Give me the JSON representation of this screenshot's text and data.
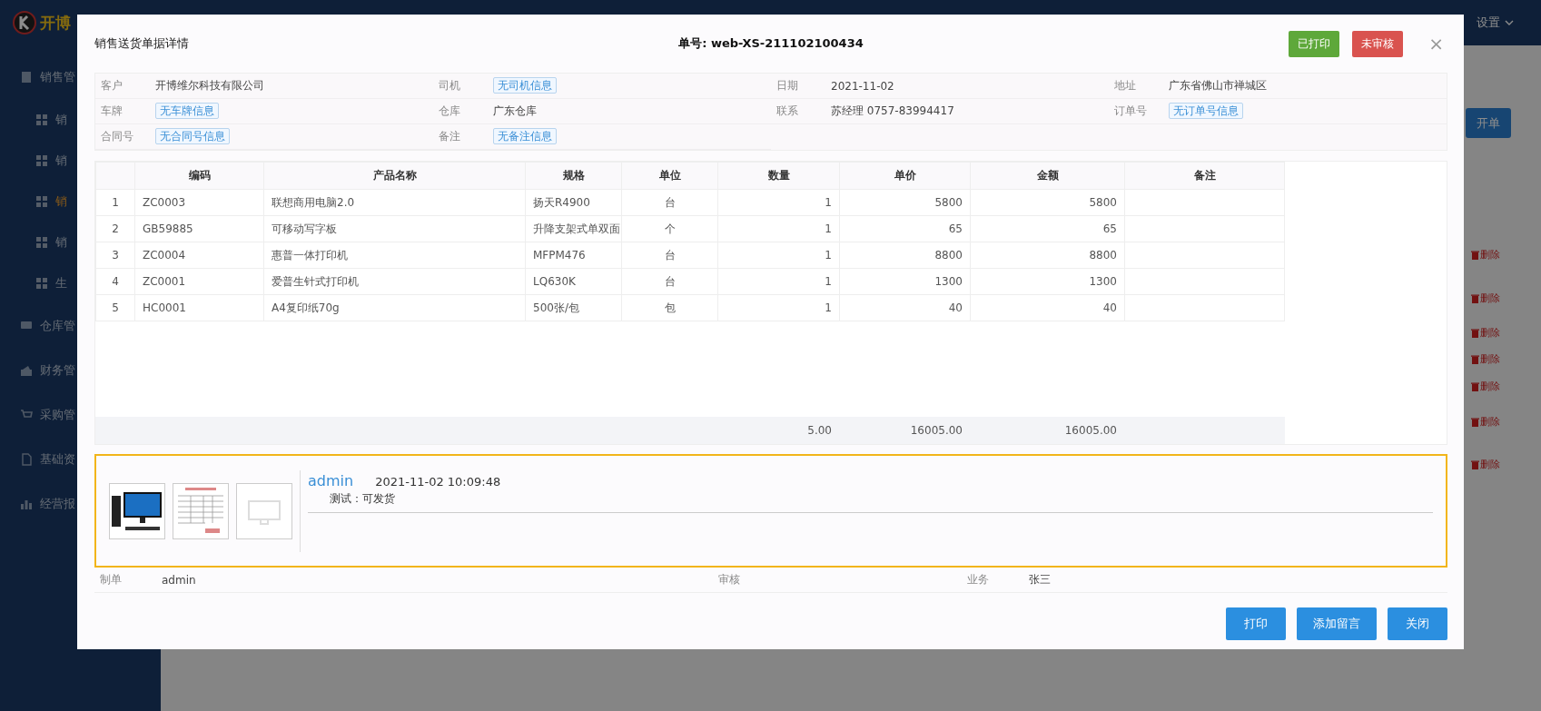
{
  "app": {
    "logo_text": "开博",
    "settings": "设置"
  },
  "sidebar": {
    "items": [
      {
        "label": "销售管",
        "children": [
          {
            "label": "销",
            "selected": false
          },
          {
            "label": "销",
            "selected": false
          },
          {
            "label": "销",
            "selected": true
          },
          {
            "label": "销",
            "selected": false
          },
          {
            "label": "生",
            "selected": false
          }
        ]
      },
      {
        "label": "仓库管"
      },
      {
        "label": "财务管"
      },
      {
        "label": "采购管"
      },
      {
        "label": "基础资"
      },
      {
        "label": "经营报"
      }
    ]
  },
  "background": {
    "new_button": "开单",
    "delete_links": [
      "删除",
      "删除",
      "删除",
      "删除",
      "删除",
      "删除",
      "删除"
    ]
  },
  "dialog": {
    "title": "销售送货单据详情",
    "number": "单号: web-XS-211102100434",
    "badges": [
      {
        "label": "已打印",
        "color": "#5ea83a"
      },
      {
        "label": "未审核",
        "color": "#d9534f"
      }
    ],
    "close": "×",
    "fields": [
      {
        "label": "客户",
        "value": "开博维尔科技有限公司",
        "kind": "text"
      },
      {
        "label": "司机",
        "value": "无司机信息",
        "kind": "tag"
      },
      {
        "label": "日期",
        "value": "2021-11-02",
        "kind": "text"
      },
      {
        "label": "地址",
        "value": "广东省佛山市禅城区",
        "kind": "text"
      },
      {
        "label": "车牌",
        "value": "无车牌信息",
        "kind": "tag"
      },
      {
        "label": "仓库",
        "value": "广东仓库",
        "kind": "text"
      },
      {
        "label": "联系",
        "value": "苏经理 0757-83994417",
        "kind": "text"
      },
      {
        "label": "订单号",
        "value": "无订单号信息",
        "kind": "tag"
      },
      {
        "label": "合同号",
        "value": "无合同号信息",
        "kind": "tag"
      },
      {
        "label": "备注",
        "value": "无备注信息",
        "kind": "tag"
      }
    ],
    "table": {
      "columns": [
        "编码",
        "产品名称",
        "规格",
        "单位",
        "数量",
        "单价",
        "金额",
        "备注"
      ],
      "rows": [
        {
          "no": "1",
          "code": "ZC0003",
          "name": "联想商用电脑2.0",
          "spec": "扬天R4900",
          "unit": "台",
          "qty": "1",
          "price": "5800",
          "amount": "5800"
        },
        {
          "no": "2",
          "code": "GB59885",
          "name": "可移动写字板",
          "spec": "升降支架式单双面",
          "unit": "个",
          "qty": "1",
          "price": "65",
          "amount": "65"
        },
        {
          "no": "3",
          "code": "ZC0004",
          "name": "惠普一体打印机",
          "spec": "MFPM476",
          "unit": "台",
          "qty": "1",
          "price": "8800",
          "amount": "8800"
        },
        {
          "no": "4",
          "code": "ZC0001",
          "name": "爱普生针式打印机",
          "spec": "LQ630K",
          "unit": "台",
          "qty": "1",
          "price": "1300",
          "amount": "1300"
        },
        {
          "no": "5",
          "code": "HC0001",
          "name": "A4复印纸70g",
          "spec": "500张/包",
          "unit": "包",
          "qty": "1",
          "price": "40",
          "amount": "40"
        }
      ],
      "totals": {
        "qty": "5.00",
        "price": "16005.00",
        "amount": "16005.00"
      }
    },
    "message": {
      "attachments": [
        {
          "kind": "photo"
        },
        {
          "kind": "document"
        },
        {
          "kind": "empty"
        }
      ],
      "author": "admin",
      "time": "2021-11-02 10:09:48",
      "text": "测试：可发货"
    },
    "footer": [
      {
        "label": "制单",
        "value": "admin"
      },
      {
        "label": "审核"
      },
      {
        "label": "业务",
        "value": "张三"
      }
    ],
    "buttons": [
      "打印",
      "添加留言",
      "关闭"
    ]
  }
}
